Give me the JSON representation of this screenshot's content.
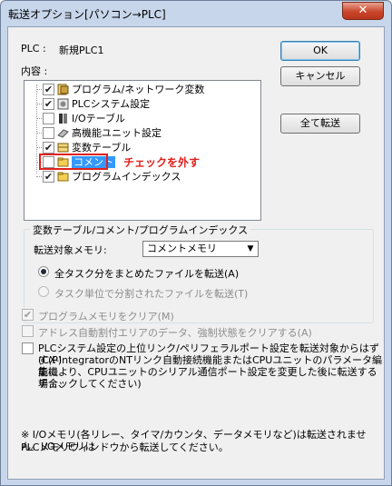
{
  "window": {
    "title": "転送オプション[パソコン→PLC]",
    "close_glyph": "✕"
  },
  "plc": {
    "label": "PLC :",
    "name": "新規PLC1"
  },
  "contents_label": "内容 :",
  "tree": [
    {
      "label": "プログラム/ネットワーク変数",
      "checked": true,
      "icon": "program-network-icon"
    },
    {
      "label": "PLCシステム設定",
      "checked": true,
      "icon": "plc-settings-icon"
    },
    {
      "label": "I/Oテーブル",
      "checked": false,
      "icon": "io-table-icon"
    },
    {
      "label": "高機能ユニット設定",
      "checked": false,
      "icon": "special-unit-icon"
    },
    {
      "label": "変数テーブル",
      "checked": true,
      "icon": "variable-table-icon"
    },
    {
      "label": "コメント",
      "checked": false,
      "icon": "comment-folder-icon",
      "selected": true
    },
    {
      "label": "プログラムインデックス",
      "checked": true,
      "icon": "program-index-folder-icon"
    }
  ],
  "annotation": {
    "text": "チェックを外す",
    "color": "#e0201c"
  },
  "buttons": {
    "ok": "OK",
    "cancel": "キャンセル",
    "transfer_all": "全て転送"
  },
  "group": {
    "title": "変数テーブル/コメント/プログラムインデックス",
    "target_memory_label": "転送対象メモリ:",
    "target_memory_value": "コメントメモリ",
    "radio_all": "全タスク分をまとめたファイルを転送(A)",
    "radio_task": "タスク単位で分割されたファイルを転送(T)"
  },
  "options": {
    "clear_program_memory": "プログラムメモリをクリア(M)",
    "clear_address_area": "アドレス自動割付エリアのデータ、強制状態をクリアする(A)",
    "plc_settings_line1": "PLCシステム設定の上位リンク/ペリフェラルポート設定を転送対象からはずす(P)",
    "plc_settings_line2": "(CX-IntegratorのNTリンク自動接続機能またはCPUユニットのパラメータ編集機",
    "plc_settings_line3": "能により、CPUユニットのシリアル通信ポート設定を変更した後に転送する場合、",
    "plc_settings_line4": "チェックしてください)"
  },
  "footer": {
    "line1": "※ I/Oメモリ(各リレー、タイマ/カウンタ、データメモリなど)は転送されません。I/Oメモリは",
    "line2": "PLCメモリウィンドウから転送してください。"
  },
  "colors": {
    "selection": "#3399ff",
    "annotation_red": "#e0201c"
  }
}
